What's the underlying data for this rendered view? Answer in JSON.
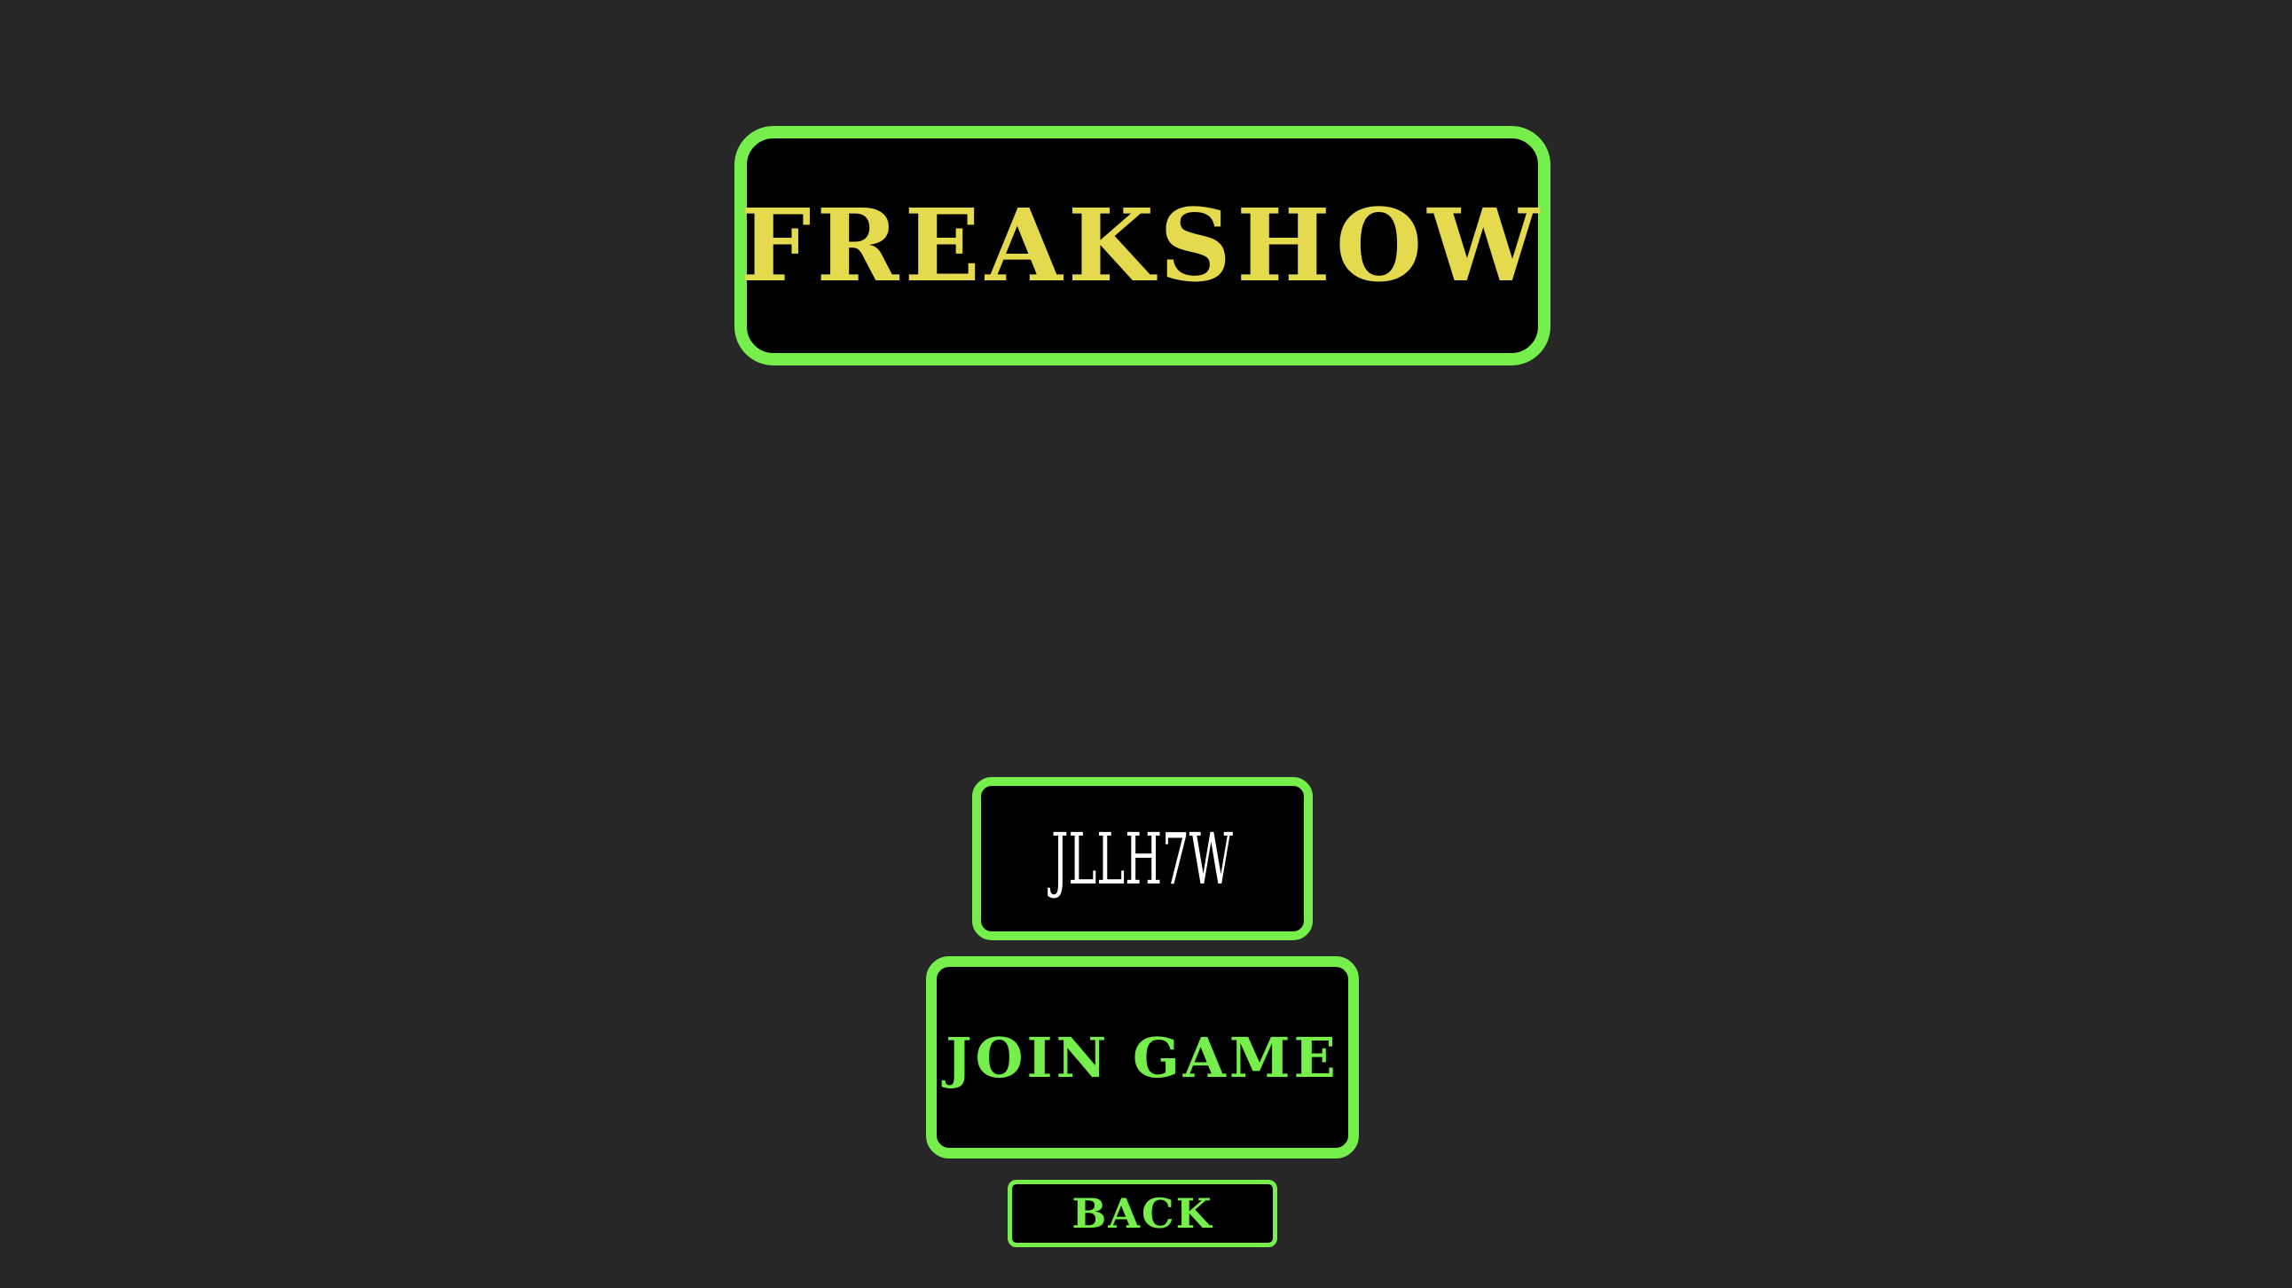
{
  "title": "FREAKSHOW",
  "room_code": "JLLH7W",
  "join_button_label": "JOIN GAME",
  "back_button_label": "BACK",
  "colors": {
    "background": "#272727",
    "accent": "#76ee4b",
    "title_text": "#e5d94d",
    "box_fill": "#000000",
    "code_text": "#ffffff"
  }
}
